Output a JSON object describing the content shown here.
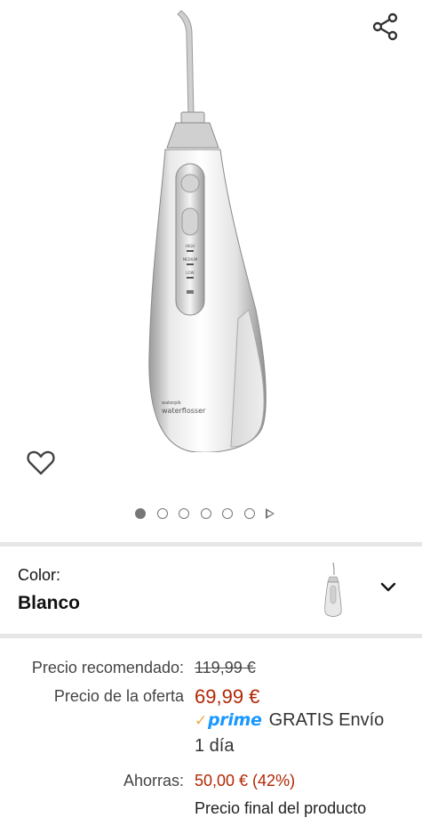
{
  "icons": {
    "share": "share-icon",
    "wishlist": "heart-icon",
    "color_dropdown": "chevron-down-icon",
    "carousel_next": "play-triangle-icon"
  },
  "product_image": {
    "brand_logo_small": "waterpik",
    "brand_logo_text": "waterflosser",
    "button_labels": [
      "HIGH",
      "MEDIUM",
      "LOW"
    ]
  },
  "carousel": {
    "total_dots": 6,
    "active_index": 0
  },
  "color": {
    "label": "Color:",
    "value": "Blanco"
  },
  "prices": {
    "recommended_label": "Precio recomendado:",
    "recommended_value": "119,99 €",
    "offer_label": "Precio de la oferta",
    "offer_value": "69,99 €",
    "prime_label": "prime",
    "shipping_line1": "GRATIS Envío",
    "shipping_line2": "1 día",
    "savings_label": "Ahorras:",
    "savings_value": "50,00 € (42%)",
    "final_price_note": "Precio final del producto"
  },
  "colors": {
    "accent_price": "#B12704",
    "prime_blue": "#1a98ff",
    "prime_check": "#f3a847",
    "divider": "#e6e6e6"
  }
}
